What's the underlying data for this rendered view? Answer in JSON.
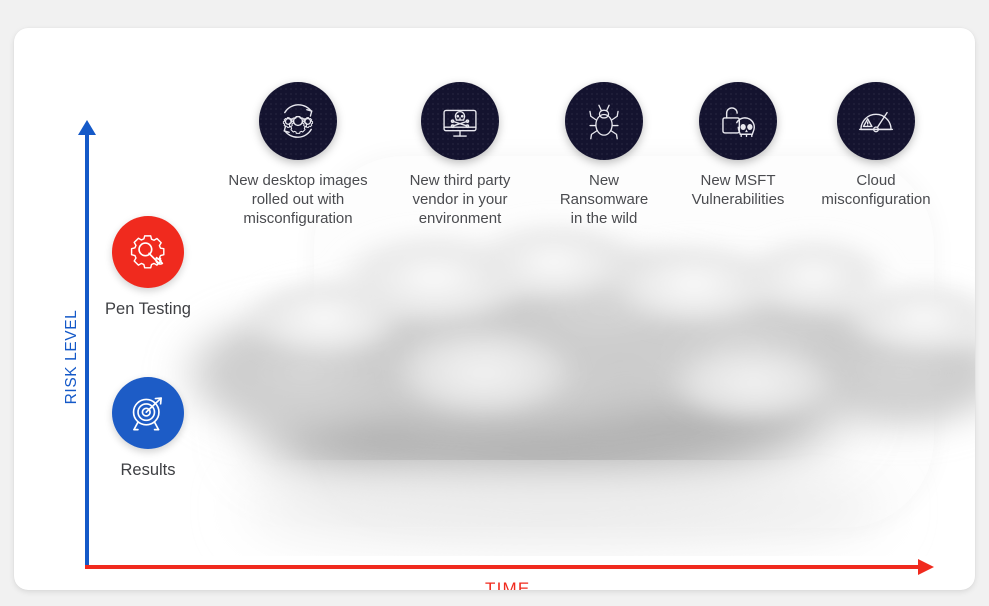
{
  "canvas": {
    "background_color": "#f1f1f1",
    "card_background": "#ffffff"
  },
  "axes": {
    "y_label": "RISK LEVEL",
    "y_color": "#1459c8",
    "x_label": "TIME",
    "x_color": "#f02a1e"
  },
  "legend": {
    "items": [
      {
        "label": "Pen Testing",
        "color": "#f02a1e",
        "icon": "gear-wrench-icon"
      },
      {
        "label": "Results",
        "color": "#1d5cc6",
        "icon": "target-arrow-icon"
      }
    ]
  },
  "threats": {
    "circle_color": "#14132f",
    "items": [
      {
        "label": "New desktop images rolled out with misconfiguration",
        "lines": [
          "New desktop images",
          "rolled out with",
          "misconfiguration"
        ],
        "icon": "gears-refresh-icon"
      },
      {
        "label": "New third party vendor in your environment",
        "lines": [
          "New third party",
          "vendor in your",
          "environment"
        ],
        "icon": "monitor-skull-icon"
      },
      {
        "label": "New Ransomware in the wild",
        "lines": [
          "New",
          "Ransomware",
          "in the wild"
        ],
        "icon": "bug-icon"
      },
      {
        "label": "New MSFT Vulnerabilities",
        "lines": [
          "New MSFT",
          "Vulnerabilities"
        ],
        "icon": "unlocked-padlock-skull-icon"
      },
      {
        "label": "Cloud misconfiguration",
        "lines": [
          "Cloud",
          "misconfiguration"
        ],
        "icon": "gauge-warning-icon"
      }
    ]
  },
  "cloud": {
    "name": "smoke-cloud-graphic",
    "description": "grey smoke cloud filling the chart area"
  }
}
